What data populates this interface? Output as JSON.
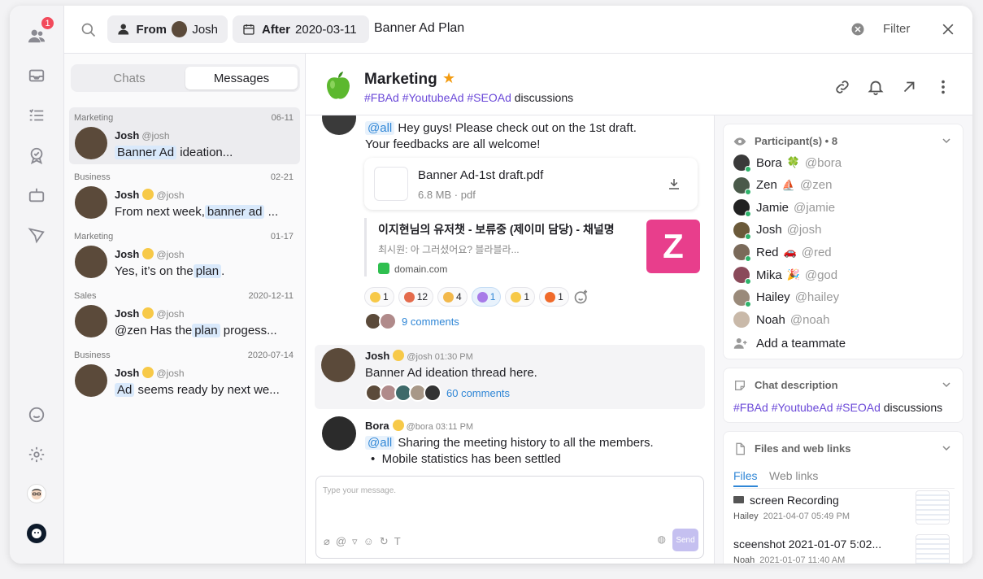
{
  "rail": {
    "notification_count": "1"
  },
  "search": {
    "from_label": "From",
    "from_user": "Josh",
    "after_label": "After",
    "after_date": "2020-03-11",
    "query": "Banner Ad Plan",
    "filter_label": "Filter"
  },
  "tabs": {
    "chats": "Chats",
    "messages": "Messages"
  },
  "results": [
    {
      "channel": "Marketing",
      "date": "06-11",
      "name": "Josh",
      "handle": "@josh",
      "hl": "Banner Ad",
      "pre": "",
      "post": " ideation...",
      "has_emoji": false
    },
    {
      "channel": "Business",
      "date": "02-21",
      "name": "Josh",
      "handle": "@josh",
      "pre": "From next week,",
      "hl": "banner ad",
      "post": " ...",
      "has_emoji": true
    },
    {
      "channel": "Marketing",
      "date": "01-17",
      "name": "Josh",
      "handle": "@josh",
      "pre": "Yes, it’s on the",
      "hl": "plan",
      "post": ".",
      "has_emoji": true
    },
    {
      "channel": "Sales",
      "date": "2020-12-11",
      "name": "Josh",
      "handle": "@josh",
      "pre": "@zen Has the",
      "hl": "plan",
      "post": " progess...",
      "has_emoji": true
    },
    {
      "channel": "Business",
      "date": "2020-07-14",
      "name": "Josh",
      "handle": "@josh",
      "pre": "",
      "hl": "Ad",
      "post": " seems ready by next we...",
      "has_emoji": true
    }
  ],
  "channel": {
    "title": "Marketing",
    "tags": [
      "#FBAd",
      "#YoutubeAd",
      "#SEOAd"
    ],
    "suffix": "discussions"
  },
  "messages": {
    "m1": {
      "mention": "@all",
      "line1": " Hey guys! Please check out on the 1st draft.",
      "line2": "Your feedbacks are all welcome!"
    },
    "file": {
      "name": "Banner Ad-1st draft.pdf",
      "meta": "6.8 MB · pdf"
    },
    "link": {
      "title": "이지현님의 유저챗 - 보류중 (제이미 담당) - 채널명",
      "desc": "최시원: 아 그러셨어요? 블라블라...",
      "domain": "domain.com",
      "logo": "Z"
    },
    "reactions": [
      {
        "count": "1",
        "color": "#f7c948",
        "me": false
      },
      {
        "count": "12",
        "color": "#e46b4c",
        "me": false
      },
      {
        "count": "4",
        "color": "#f2b84b",
        "me": false
      },
      {
        "count": "1",
        "color": "#a77be8",
        "me": true
      },
      {
        "count": "1",
        "color": "#f7c948",
        "me": false
      },
      {
        "count": "1",
        "color": "#f06a2a",
        "me": false
      }
    ],
    "m1_comments": "9 comments",
    "m2": {
      "name": "Josh",
      "handle": "@josh",
      "time": "01:30 PM",
      "text": "Banner Ad ideation thread here.",
      "comments": "60 comments"
    },
    "m3": {
      "name": "Bora",
      "handle": "@bora",
      "time": "03:11 PM",
      "mention": "@all",
      "text": " Sharing the meeting history to all the members.",
      "bullet1": "Mobile statistics has been settled"
    }
  },
  "composer": {
    "placeholder": "Type your message.",
    "send": "Send"
  },
  "info": {
    "participants_title": "Participant(s) • 8",
    "participants": [
      {
        "name": "Bora",
        "emoji": "🍀",
        "handle": "@bora",
        "color": "#3a3a3a"
      },
      {
        "name": "Zen",
        "emoji": "⛵",
        "handle": "@zen",
        "color": "#4a5a4a"
      },
      {
        "name": "Jamie",
        "emoji": "",
        "handle": "@jamie",
        "color": "#222"
      },
      {
        "name": "Josh",
        "emoji": "",
        "handle": "@josh",
        "color": "#6b5a3a"
      },
      {
        "name": "Red",
        "emoji": "🚗",
        "handle": "@red",
        "color": "#7a6a5a"
      },
      {
        "name": "Mika",
        "emoji": "🎉",
        "handle": "@god",
        "color": "#8a4a5a"
      },
      {
        "name": "Hailey",
        "emoji": "",
        "handle": "@hailey",
        "color": "#9a8a7a"
      },
      {
        "name": "Noah",
        "emoji": "",
        "handle": "@noah",
        "color": "#c9b9a9"
      }
    ],
    "add_teammate": "Add a teammate",
    "desc_title": "Chat description",
    "desc_tags": [
      "#FBAd",
      "#YoutubeAd",
      "#SEOAd"
    ],
    "desc_suffix": "discussions",
    "files_title": "Files and web links",
    "files_tab": "Files",
    "links_tab": "Web links",
    "files": [
      {
        "name": "screen Recording",
        "user": "Hailey",
        "date": "2021-04-07 05:49 PM"
      },
      {
        "name": "sceenshot 2021-01-07 5:02...",
        "user": "Noah",
        "date": "2021-01-07 11:40 AM"
      }
    ]
  },
  "colors": {
    "accent": "#2f86d6",
    "tag": "#6a48d8",
    "badge": "#f24a5b",
    "star": "#f39c12",
    "logo_bg": "#e83e8c"
  }
}
